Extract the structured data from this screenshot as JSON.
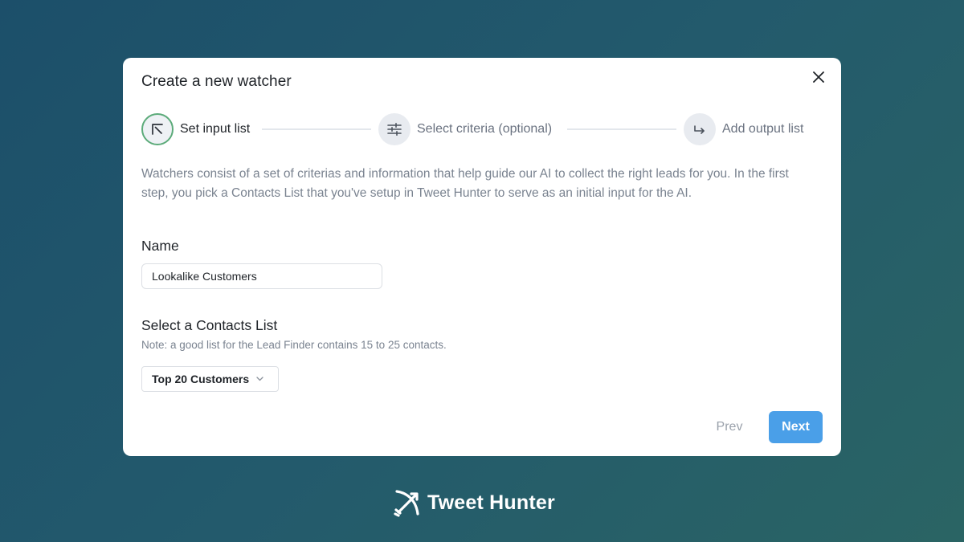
{
  "modal": {
    "title": "Create a new watcher",
    "close_icon": "close-icon"
  },
  "steps": [
    {
      "label": "Set input list",
      "icon": "arrow-up-left-icon",
      "state": "active"
    },
    {
      "label": "Select criteria (optional)",
      "icon": "sliders-icon",
      "state": "upcoming"
    },
    {
      "label": "Add output list",
      "icon": "arrow-right-hook-icon",
      "state": "upcoming"
    }
  ],
  "description": "Watchers consist of a set of criterias and information that help guide our AI to collect the right leads for you. In the first step, you pick a Contacts List that you've setup in Tweet Hunter to serve as an initial input for the AI.",
  "name_field": {
    "label": "Name",
    "value": "Lookalike Customers"
  },
  "contacts_list": {
    "label": "Select a Contacts List",
    "note": "Note: a good list for the Lead Finder contains 15 to 25 contacts.",
    "selected": "Top 20 Customers"
  },
  "footer": {
    "prev_label": "Prev",
    "next_label": "Next"
  },
  "brand": {
    "name": "Tweet Hunter",
    "logo_icon": "bow-arrow-logo-icon"
  },
  "colors": {
    "background": "#1f5368",
    "accent": "#4a9fe8",
    "active_step_border": "#5cab7a"
  }
}
